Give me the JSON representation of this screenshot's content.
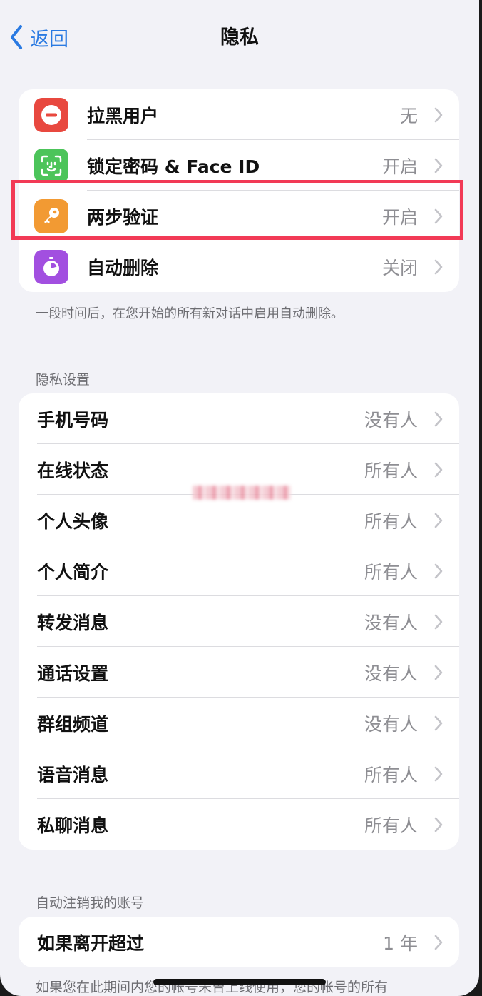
{
  "nav": {
    "back_label": "返回",
    "title": "隐私"
  },
  "security_items": [
    {
      "label": "拉黑用户",
      "value": "无",
      "icon": "block-icon",
      "color": "#e8483f"
    },
    {
      "label": "锁定密码 & Face ID",
      "value": "开启",
      "icon": "face-id-icon",
      "color": "#4cc45a"
    },
    {
      "label": "两步验证",
      "value": "开启",
      "icon": "key-icon",
      "color": "#f29a33"
    },
    {
      "label": "自动删除",
      "value": "关闭",
      "icon": "timer-icon",
      "color": "#a24fe0"
    }
  ],
  "security_footnote": "一段时间后，在您开始的所有新对话中启用自动删除。",
  "privacy_section": {
    "header": "隐私设置",
    "items": [
      {
        "label": "手机号码",
        "value": "没有人"
      },
      {
        "label": "在线状态",
        "value": "所有人"
      },
      {
        "label": "个人头像",
        "value": "所有人"
      },
      {
        "label": "个人简介",
        "value": "所有人"
      },
      {
        "label": "转发消息",
        "value": "没有人"
      },
      {
        "label": "通话设置",
        "value": "没有人"
      },
      {
        "label": "群组频道",
        "value": "没有人"
      },
      {
        "label": "语音消息",
        "value": "所有人"
      },
      {
        "label": "私聊消息",
        "value": "所有人"
      }
    ]
  },
  "account_section": {
    "header": "自动注销我的账号",
    "item": {
      "label": "如果离开超过",
      "value": "1 年"
    },
    "footnote": "如果您在此期间内您的帐号未曾上线使用，您的帐号的所有"
  },
  "colors": {
    "accent": "#2a7ae2",
    "highlight": "#f23a56"
  }
}
